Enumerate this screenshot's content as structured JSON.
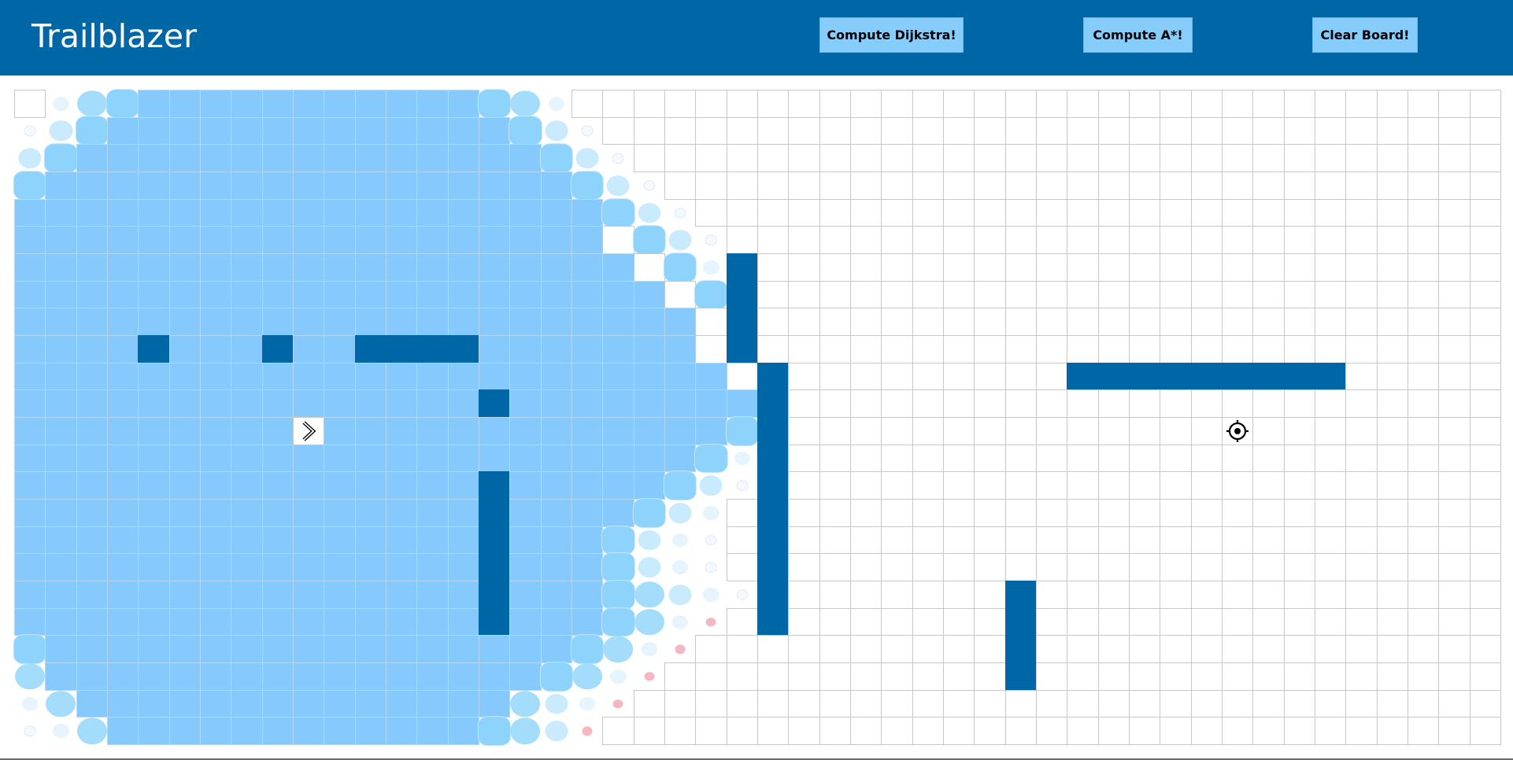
{
  "app": {
    "title": "Trailblazer"
  },
  "toolbar": {
    "dijkstra_label": "Compute Dijkstra!",
    "astar_label": "Compute A*!",
    "clear_label": "Clear Board!"
  },
  "colors": {
    "header": "#0067a7",
    "button": "#87cdfc",
    "visited": "#86c9fc",
    "wall": "#0067a7",
    "grid_line": "#c8c8c8"
  },
  "icons": {
    "start": "chevron-right-icon",
    "target": "crosshair-target-icon"
  },
  "grid": {
    "rows": 24,
    "cols": 48,
    "start": [
      12,
      9
    ],
    "target": [
      12,
      39
    ],
    "walls": [
      [
        6,
        23
      ],
      [
        7,
        23
      ],
      [
        8,
        23
      ],
      [
        9,
        23
      ],
      [
        10,
        24
      ],
      [
        11,
        24
      ],
      [
        12,
        24
      ],
      [
        13,
        24
      ],
      [
        14,
        24
      ],
      [
        15,
        24
      ],
      [
        16,
        24
      ],
      [
        17,
        24
      ],
      [
        18,
        24
      ],
      [
        19,
        24
      ],
      [
        9,
        4
      ],
      [
        9,
        8
      ],
      [
        9,
        11
      ],
      [
        9,
        12
      ],
      [
        9,
        13
      ],
      [
        9,
        14
      ],
      [
        11,
        15
      ],
      [
        14,
        15
      ],
      [
        15,
        15
      ],
      [
        16,
        15
      ],
      [
        17,
        15
      ],
      [
        18,
        15
      ],
      [
        19,
        15
      ],
      [
        10,
        34
      ],
      [
        10,
        35
      ],
      [
        10,
        36
      ],
      [
        10,
        37
      ],
      [
        10,
        38
      ],
      [
        10,
        39
      ],
      [
        10,
        40
      ],
      [
        10,
        41
      ],
      [
        10,
        42
      ],
      [
        18,
        32
      ],
      [
        19,
        32
      ],
      [
        20,
        32
      ],
      [
        21,
        32
      ]
    ],
    "visited_ranges": [
      [
        0,
        3,
        14
      ],
      [
        1,
        3,
        15
      ],
      [
        2,
        2,
        16
      ],
      [
        3,
        1,
        17
      ],
      [
        4,
        0,
        18
      ],
      [
        5,
        0,
        18
      ],
      [
        6,
        0,
        19
      ],
      [
        7,
        0,
        20
      ],
      [
        8,
        0,
        21
      ],
      [
        9,
        0,
        21
      ],
      [
        10,
        0,
        22
      ],
      [
        11,
        0,
        23
      ],
      [
        12,
        0,
        23
      ],
      [
        13,
        0,
        23
      ],
      [
        14,
        0,
        23
      ],
      [
        15,
        0,
        22
      ],
      [
        16,
        0,
        21
      ],
      [
        17,
        0,
        20
      ],
      [
        18,
        0,
        19
      ],
      [
        19,
        0,
        18
      ],
      [
        20,
        0,
        18
      ],
      [
        21,
        0,
        17
      ],
      [
        22,
        1,
        16
      ],
      [
        23,
        3,
        14
      ]
    ],
    "blank_cells": [
      [
        0,
        0
      ]
    ],
    "animated_cells": [
      [
        0,
        1,
        4
      ],
      [
        0,
        2,
        2
      ],
      [
        0,
        3,
        1
      ],
      [
        0,
        15,
        1
      ],
      [
        0,
        16,
        2
      ],
      [
        0,
        17,
        4
      ],
      [
        1,
        0,
        5
      ],
      [
        1,
        1,
        3
      ],
      [
        1,
        2,
        1
      ],
      [
        1,
        16,
        1
      ],
      [
        1,
        17,
        3
      ],
      [
        1,
        18,
        5
      ],
      [
        2,
        0,
        3
      ],
      [
        2,
        1,
        1
      ],
      [
        2,
        17,
        1
      ],
      [
        2,
        18,
        3
      ],
      [
        2,
        19,
        5
      ],
      [
        3,
        0,
        1
      ],
      [
        3,
        18,
        1
      ],
      [
        3,
        19,
        3
      ],
      [
        3,
        20,
        5
      ],
      [
        4,
        19,
        1
      ],
      [
        4,
        20,
        3
      ],
      [
        4,
        21,
        5
      ],
      [
        5,
        20,
        1
      ],
      [
        5,
        21,
        3
      ],
      [
        5,
        22,
        5
      ],
      [
        6,
        21,
        1
      ],
      [
        6,
        22,
        4
      ],
      [
        7,
        22,
        1
      ],
      [
        7,
        23,
        5
      ],
      [
        8,
        23,
        1
      ],
      [
        12,
        23,
        1
      ],
      [
        13,
        22,
        1
      ],
      [
        13,
        23,
        4
      ],
      [
        14,
        21,
        1
      ],
      [
        14,
        22,
        3
      ],
      [
        14,
        23,
        5
      ],
      [
        15,
        20,
        1
      ],
      [
        15,
        21,
        3
      ],
      [
        15,
        22,
        4
      ],
      [
        16,
        19,
        1
      ],
      [
        16,
        20,
        3
      ],
      [
        16,
        21,
        4
      ],
      [
        16,
        22,
        5
      ],
      [
        17,
        19,
        1
      ],
      [
        17,
        20,
        3
      ],
      [
        17,
        21,
        4
      ],
      [
        17,
        22,
        5
      ],
      [
        18,
        19,
        1
      ],
      [
        18,
        20,
        2
      ],
      [
        18,
        21,
        3
      ],
      [
        18,
        22,
        4
      ],
      [
        18,
        23,
        5
      ],
      [
        19,
        19,
        1
      ],
      [
        19,
        20,
        2
      ],
      [
        19,
        21,
        4
      ],
      [
        19,
        22,
        6
      ],
      [
        20,
        0,
        1
      ],
      [
        20,
        18,
        1
      ],
      [
        20,
        19,
        2
      ],
      [
        20,
        20,
        4
      ],
      [
        20,
        21,
        6
      ],
      [
        21,
        0,
        2
      ],
      [
        21,
        17,
        1
      ],
      [
        21,
        18,
        2
      ],
      [
        21,
        19,
        4
      ],
      [
        21,
        20,
        6
      ],
      [
        22,
        0,
        4
      ],
      [
        22,
        1,
        2
      ],
      [
        22,
        16,
        2
      ],
      [
        22,
        17,
        3
      ],
      [
        22,
        18,
        4
      ],
      [
        22,
        19,
        6
      ],
      [
        23,
        0,
        5
      ],
      [
        23,
        1,
        4
      ],
      [
        23,
        2,
        2
      ],
      [
        23,
        15,
        1
      ],
      [
        23,
        16,
        2
      ],
      [
        23,
        17,
        3
      ],
      [
        23,
        18,
        6
      ]
    ]
  }
}
